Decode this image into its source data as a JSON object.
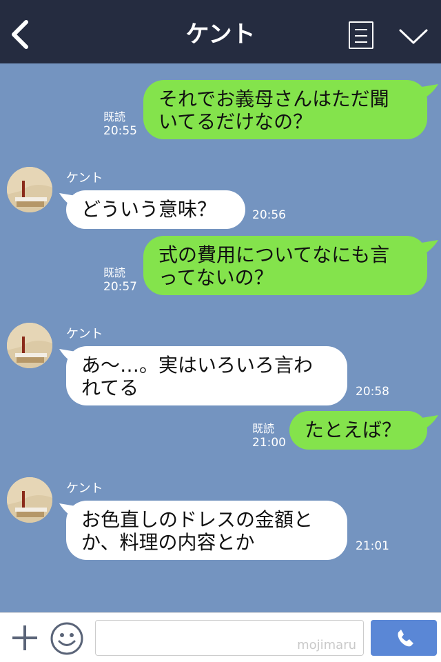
{
  "header": {
    "title": "ケント"
  },
  "contact": {
    "name": "ケント"
  },
  "read_label": "既読",
  "messages": [
    {
      "dir": "out",
      "text1": "それでお義母さんはただ聞",
      "text2": "いてるだけなの？",
      "time": "20:55",
      "read": "既読"
    },
    {
      "dir": "in",
      "sender": "ケント",
      "text1": "どういう意味？",
      "time": "20:56"
    },
    {
      "dir": "out",
      "text1": "式の費用についてなにも言",
      "text2": "ってないの？",
      "time": "20:57",
      "read": "既読"
    },
    {
      "dir": "in",
      "sender": "ケント",
      "text1": "あ〜…。実はいろいろ言わ",
      "text2": "れてる",
      "time": "20:58"
    },
    {
      "dir": "out",
      "text1": "たとえば？",
      "time": "21:00",
      "read": "既読"
    },
    {
      "dir": "in",
      "sender": "ケント",
      "text1": "お色直しのドレスの金額と",
      "text2": "か、料理の内容とか",
      "time": "21:01"
    }
  ],
  "footer": {
    "watermark": "mojimaru"
  },
  "colors": {
    "header": "#252c40",
    "chat_bg": "#7494c0",
    "out_bubble": "#84e34c",
    "in_bubble": "#ffffff",
    "call_button": "#5a87d6"
  },
  "icons": {
    "back": "chevron-left-icon",
    "menu": "list-icon",
    "collapse": "chevron-down-icon",
    "plus": "plus-icon",
    "emoji": "smiley-icon",
    "call": "phone-icon"
  }
}
